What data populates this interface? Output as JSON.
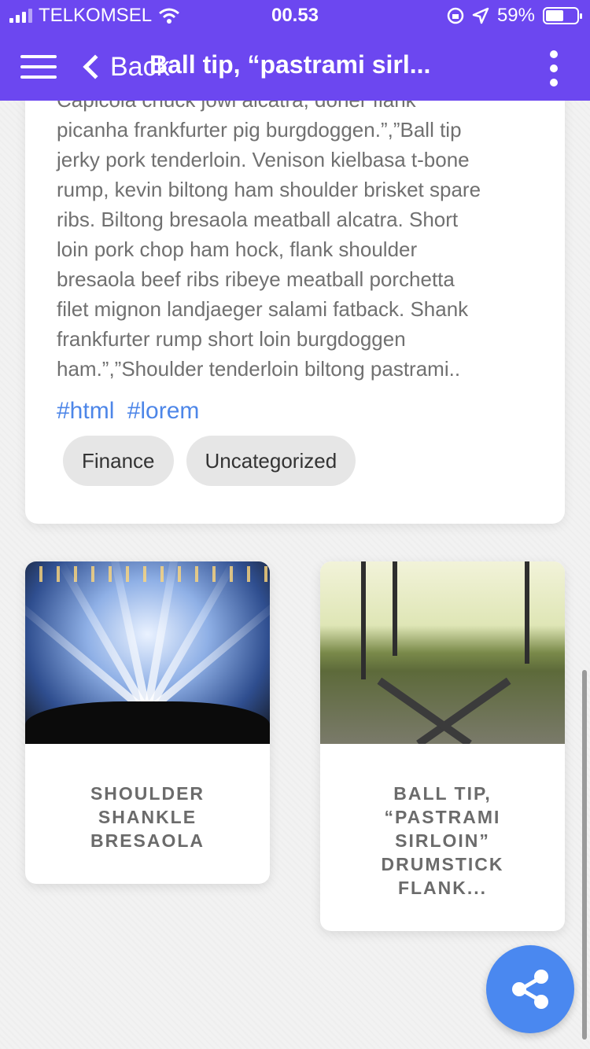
{
  "status_bar": {
    "carrier": "TELKOMSEL",
    "time": "00.53",
    "battery": "59%",
    "battery_level": 0.59
  },
  "nav": {
    "back_label": "Back",
    "title": "Ball tip, “pastrami sirl..."
  },
  "post": {
    "cut_line": "Capicola chuck jowl alcatra, doner flank",
    "body_lines": [
      "picanha frankfurter pig burgdoggen.”,”Ball tip",
      "jerky pork tenderloin. Venison kielbasa t-bone",
      "rump, kevin biltong ham shoulder brisket spare",
      "ribs. Biltong bresaola meatball alcatra. Short",
      "loin pork chop ham hock, flank shoulder",
      "bresaola beef ribs ribeye meatball porchetta",
      "filet mignon landjaeger salami fatback. Shank",
      "frankfurter rump short loin burgdoggen",
      "ham.”,”Shoulder tenderloin biltong pastrami.."
    ],
    "hashtags": [
      "#html",
      "#lorem"
    ],
    "categories": [
      "Finance",
      "Uncategorized"
    ]
  },
  "related": [
    {
      "title": "SHOULDER SHANKLE BRESAOLA",
      "image": "concert-image"
    },
    {
      "title": "BALL TIP, “PASTRAMI SIRLOIN” DRUMSTICK FLANK...",
      "image": "railway-image"
    }
  ],
  "icons": {
    "menu": "hamburger-menu-icon",
    "back": "chevron-left-icon",
    "more": "more-vertical-icon",
    "share": "share-icon"
  },
  "colors": {
    "appbar": "#6c47f0",
    "accent": "#4a88f0",
    "hashtag": "#4d86e8"
  }
}
